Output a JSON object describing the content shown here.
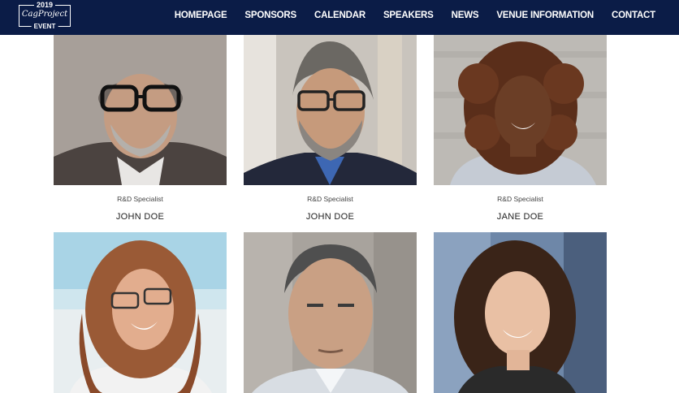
{
  "logo": {
    "year": "2019",
    "name": "CagProject",
    "event": "EVENT"
  },
  "nav": [
    "HOMEPAGE",
    "SPONSORS",
    "CALENDAR",
    "SPEAKERS",
    "NEWS",
    "VENUE INFORMATION",
    "CONTACT"
  ],
  "speakers": [
    {
      "role": "R&D Specialist",
      "name": "JOHN DOE"
    },
    {
      "role": "R&D Specialist",
      "name": "JOHN DOE"
    },
    {
      "role": "R&D Specialist",
      "name": "JANE DOE"
    },
    {
      "role": "",
      "name": ""
    },
    {
      "role": "",
      "name": ""
    },
    {
      "role": "",
      "name": ""
    }
  ]
}
